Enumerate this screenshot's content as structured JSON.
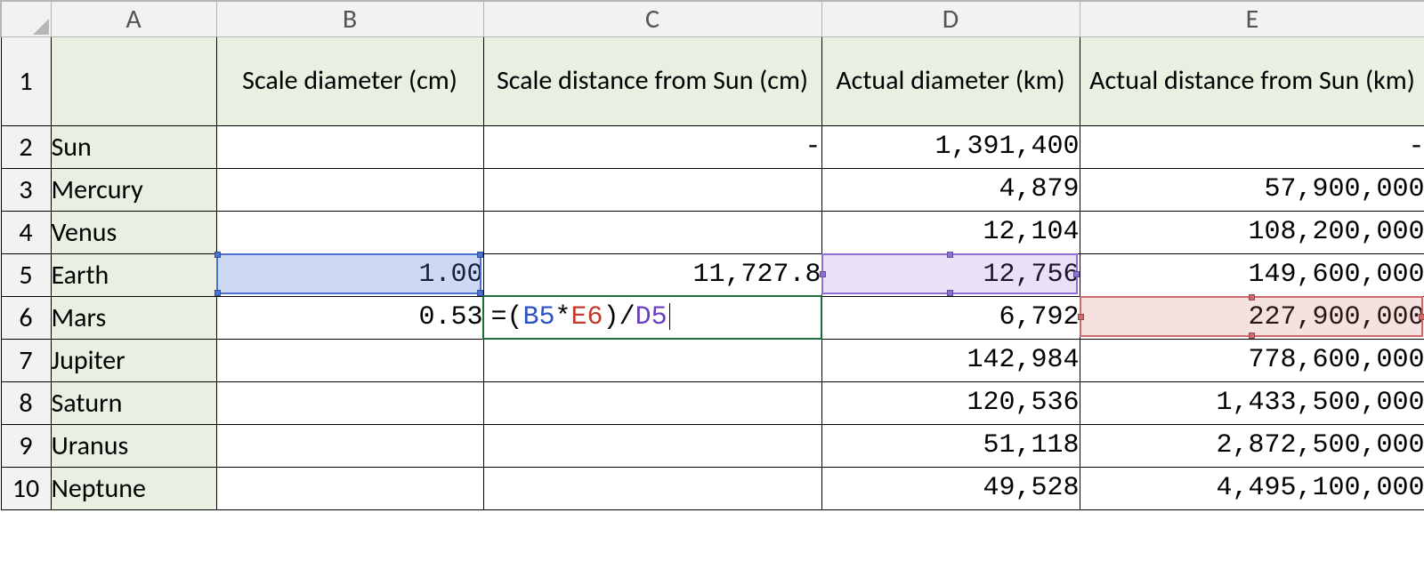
{
  "columns": [
    "A",
    "B",
    "C",
    "D",
    "E"
  ],
  "rowNumbers": [
    "1",
    "2",
    "3",
    "4",
    "5",
    "6",
    "7",
    "8",
    "9",
    "10"
  ],
  "headers": {
    "B": "Scale diameter (cm)",
    "C": "Scale distance from Sun (cm)",
    "D": "Actual diameter (km)",
    "E": "Actual distance from Sun (km)"
  },
  "rows": [
    {
      "label": "Sun",
      "B": "",
      "C": "-",
      "D": "1,391,400",
      "E": "-"
    },
    {
      "label": "Mercury",
      "B": "",
      "C": "",
      "D": "4,879",
      "E": "57,900,000"
    },
    {
      "label": "Venus",
      "B": "",
      "C": "",
      "D": "12,104",
      "E": "108,200,000"
    },
    {
      "label": "Earth",
      "B": "1.00",
      "C": "11,727.8",
      "D": "12,756",
      "E": "149,600,000"
    },
    {
      "label": "Mars",
      "B": "0.53",
      "C_formula": {
        "parts": [
          {
            "t": "=(",
            "c": "black"
          },
          {
            "t": "B5",
            "c": "blue"
          },
          {
            "t": "*",
            "c": "black"
          },
          {
            "t": "E6",
            "c": "red"
          },
          {
            "t": ")/",
            "c": "black"
          },
          {
            "t": "D5",
            "c": "purple"
          }
        ]
      },
      "D": "6,792",
      "E": "227,900,000"
    },
    {
      "label": "Jupiter",
      "B": "",
      "C": "",
      "D": "142,984",
      "E": "778,600,000"
    },
    {
      "label": "Saturn",
      "B": "",
      "C": "",
      "D": "120,536",
      "E": "1,433,500,000"
    },
    {
      "label": "Uranus",
      "B": "",
      "C": "",
      "D": "51,118",
      "E": "2,872,500,000"
    },
    {
      "label": "Neptune",
      "B": "",
      "C": "",
      "D": "49,528",
      "E": "4,495,100,000"
    }
  ],
  "activeCell": "C6",
  "references": [
    {
      "cell": "B5",
      "style": "blue",
      "dots": "corners"
    },
    {
      "cell": "D5",
      "style": "purple",
      "dots": "mids"
    },
    {
      "cell": "E6",
      "style": "red",
      "dots": "mids"
    }
  ],
  "colWidths": {
    "rowhdr": 56,
    "A": 186,
    "B": 300,
    "C": 380,
    "D": 290,
    "E": 388
  }
}
